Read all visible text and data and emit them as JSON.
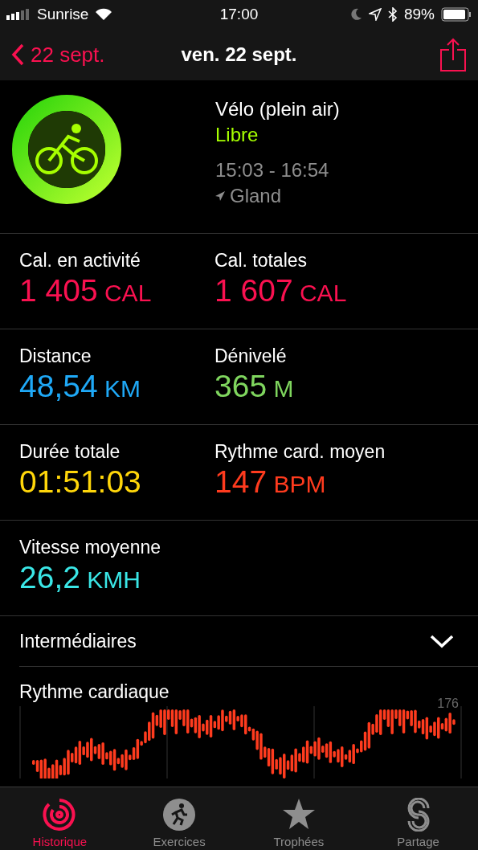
{
  "status_bar": {
    "carrier": "Sunrise",
    "time": "17:00",
    "battery": "89%"
  },
  "nav": {
    "back": "22 sept.",
    "title": "ven. 22 sept."
  },
  "workout": {
    "name": "Vélo (plein air)",
    "type": "Libre",
    "time_range": "15:03 - 16:54",
    "location": "Gland"
  },
  "metric_rows": [
    [
      {
        "label": "Cal. en activité",
        "value": "1 405",
        "unit": "CAL",
        "color": "#fa1150"
      },
      {
        "label": "Cal. totales",
        "value": "1 607",
        "unit": "CAL",
        "color": "#fa1150"
      }
    ],
    [
      {
        "label": "Distance",
        "value": "48,54",
        "unit": "KM",
        "color": "#1fa9f7"
      },
      {
        "label": "Dénivelé",
        "value": "365",
        "unit": "M",
        "color": "#7fd65e"
      }
    ],
    [
      {
        "label": "Durée totale",
        "value": "01:51:03",
        "color": "#ffd60a"
      },
      {
        "label": "Rythme card. moyen",
        "value": "147",
        "unit": "BPM",
        "color": "#ff3b1e"
      }
    ],
    [
      {
        "label": "Vitesse moyenne",
        "value": "26,2",
        "unit": "KMH",
        "color": "#3ae6e6"
      }
    ]
  ],
  "splits": {
    "label": "Intermédiaires",
    "expanded": false
  },
  "heart_rate": {
    "title": "Rythme cardiaque",
    "max_label": "176"
  },
  "tabs": [
    {
      "label": "Historique",
      "selected": true
    },
    {
      "label": "Exercices",
      "selected": false
    },
    {
      "label": "Trophées",
      "selected": false
    },
    {
      "label": "Partage",
      "selected": false
    }
  ]
}
